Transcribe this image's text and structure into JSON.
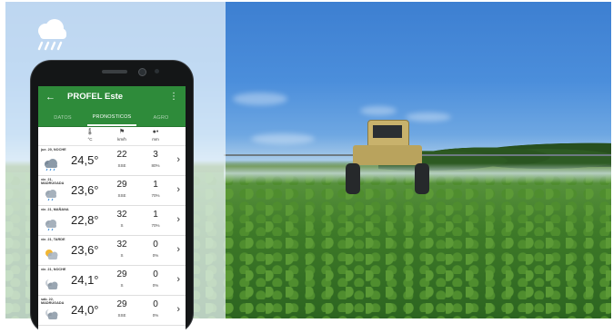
{
  "app": {
    "title": "PROFEL Este",
    "back_icon": "arrow-back-icon",
    "menu_icon": "more-vert-icon"
  },
  "tabs": [
    {
      "label": "DATOS",
      "active": false
    },
    {
      "label": "PRONOSTICOS",
      "active": true
    },
    {
      "label": "AGRO",
      "active": false
    }
  ],
  "columns": {
    "temp_unit": "°C",
    "wind_unit": "km/h",
    "rain_unit": "mm"
  },
  "forecast": [
    {
      "label": "jue. 20, NOCHE",
      "icon": "rain-cloud-icon",
      "temp": "24,5°",
      "wind": "22",
      "dir": "SSE",
      "rain": "3",
      "prob": "80%"
    },
    {
      "label": "vie. 21, MADRUGADA",
      "icon": "cloud-rain-icon",
      "temp": "23,6°",
      "wind": "29",
      "dir": "SSE",
      "rain": "1",
      "prob": "70%"
    },
    {
      "label": "vie. 21, MAÑANA",
      "icon": "cloud-rain-icon",
      "temp": "22,8°",
      "wind": "32",
      "dir": "S",
      "rain": "1",
      "prob": "70%"
    },
    {
      "label": "vie. 21, TARDE",
      "icon": "sun-cloud-icon",
      "temp": "23,6°",
      "wind": "32",
      "dir": "S",
      "rain": "0",
      "prob": "0%"
    },
    {
      "label": "vie. 21, NOCHE",
      "icon": "moon-cloud-icon",
      "temp": "24,1°",
      "wind": "29",
      "dir": "S",
      "rain": "0",
      "prob": "0%"
    },
    {
      "label": "sáb. 22, MADRUGADA",
      "icon": "moon-cloud-icon",
      "temp": "24,0°",
      "wind": "29",
      "dir": "SSE",
      "rain": "0",
      "prob": "0%"
    }
  ],
  "colors": {
    "app_bar": "#2e8b3a",
    "overlay": "#f0f8fc"
  }
}
